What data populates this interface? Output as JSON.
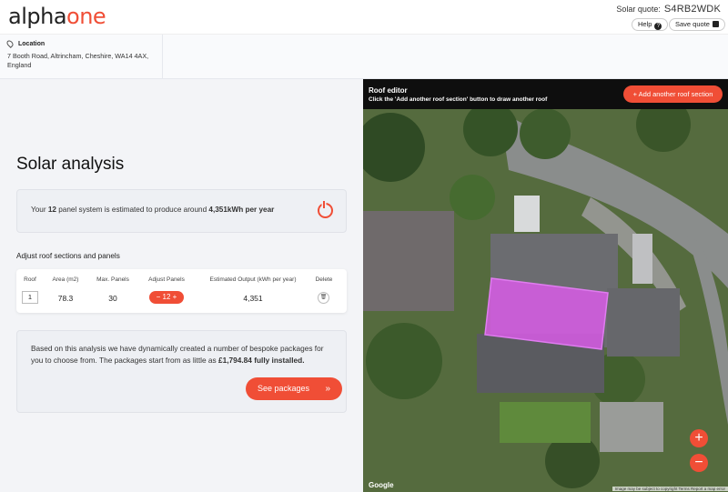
{
  "header": {
    "logo_main": "alpha",
    "logo_accent": "one",
    "quote_label": "Solar quote:",
    "quote_code": "S4RB2WDK",
    "help_label": "Help",
    "save_label": "Save quote"
  },
  "location": {
    "title": "Location",
    "address": "7 Booth Road, Altrincham, Cheshire, WA14 4AX, England"
  },
  "analysis": {
    "title": "Solar analysis",
    "estimate_pre": "Your ",
    "panel_count": "12",
    "estimate_mid": " panel system is estimated to produce around ",
    "estimate_value": "4,351kWh per year",
    "adjust_title": "Adjust roof sections and panels",
    "table": {
      "headers": [
        "Roof",
        "Area (m2)",
        "Max. Panels",
        "Adjust Panels",
        "Estimated Output (kWh per year)",
        "Delete"
      ],
      "row": {
        "roof": "1",
        "area": "78.3",
        "max_panels": "30",
        "panels": "12",
        "output": "4,351"
      }
    },
    "packages_text": "Based on this analysis we have dynamically created a number of bespoke packages for you to choose from. The packages start from as little as ",
    "packages_price": "£1,794.84 fully installed.",
    "see_packages_label": "See packages"
  },
  "map": {
    "editor_title": "Roof editor",
    "editor_subtitle": "Click the 'Add another roof section' button to draw another roof",
    "add_section_label": "+ Add another roof section",
    "google_label": "Google",
    "attribution": "Image may be subject to copyright   Terms   Report a map error"
  },
  "colors": {
    "accent": "#f04e36",
    "roof_highlight": "#d85ce6"
  }
}
